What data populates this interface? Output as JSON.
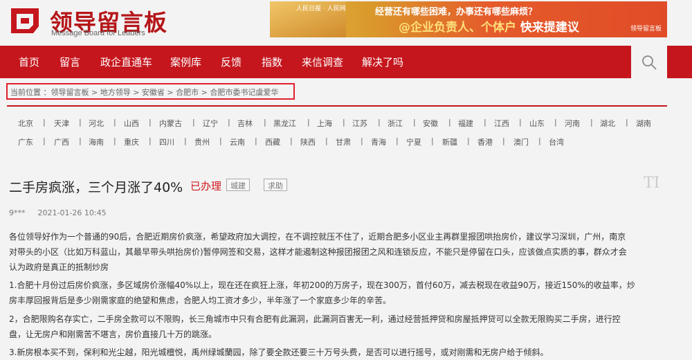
{
  "logo": {
    "title": "领导留言板",
    "subtitle": "Message Board for Leaders"
  },
  "banner": {
    "brand": "人民日报 · 人民网",
    "line1": "经营还有哪些困难，办事还有哪些麻烦？",
    "line2_prefix": "@企业负责人、个体户",
    "line2_suffix": " 快来提建议",
    "corner": "领导留言板"
  },
  "nav": {
    "items": [
      "首页",
      "留言",
      "政企直通车",
      "案例库",
      "反馈",
      "指数",
      "来信调查",
      "解决了吗"
    ]
  },
  "breadcrumb": {
    "text": "当前位置 ：领导留言板 > 地方领导 > 安徽省 > 合肥市 > 合肥市委书记虞爱华"
  },
  "regions": {
    "row1": [
      "北京",
      "天津",
      "河北",
      "山西",
      "内蒙古",
      "辽宁",
      "吉林",
      "黑龙江",
      "上海",
      "江苏",
      "浙江",
      "安徽",
      "福建",
      "江西",
      "山东",
      "河南",
      "湖北",
      "湖南"
    ],
    "row2": [
      "广东",
      "广西",
      "海南",
      "重庆",
      "四川",
      "贵州",
      "云南",
      "西藏",
      "陕西",
      "甘肃",
      "青海",
      "宁夏",
      "新疆",
      "香港",
      "澳门",
      "台湾"
    ]
  },
  "post": {
    "title": "二手房疯涨，三个月涨了40%",
    "status": "已办理",
    "tags": [
      "城建",
      "求助"
    ],
    "author": "9***",
    "date": "2021-01-26 10:45",
    "lines": [
      "各位领导好作为一个普通的90后，合肥近期房价疯涨，希望政府加大调控，在不调控就压不住了，近期合肥多小区业主再群里报团哄抬房价，建议学习深圳，广州，南京",
      "对带头的小区（比如万科蓝山，其最早带头哄抬房价)暂停网签和交易，这样才能遏制这种报团报团之风和连锁反应，不能只是停留在口头，应该做点实质的事，群众才会",
      "认为政府是真正的抵制炒房",
      "1.合肥十月份过后房价疯涨，多区域房价涨幅40%以上，现在还在疯狂上涨，年初200的万房子，现在300万，首付60万，减去税现在收益90万，接近150%的收益率，炒",
      "房丰厚回报背后是多少刚需家庭的绝望和焦虑，合肥人均工资才多少，半年涨了一个家庭多少年的辛苦。",
      "2，合肥限购名存实亡，二手房全款可以不限购，长三角城市中只有合肥有此漏洞，此漏洞百害无一利，通过经营抵押贷和房屋抵押贷可以全款无限购买二手房，进行控",
      "盘，让无房户和刚需苦不堪言，房价直接几十万的跳涨。",
      "3.新房根本买不到，保利和光尘越，阳光城檀悦，禹州绿城蘭园，除了要全款还要三十万号头费，是否可以进行摇号，或对刚需和无房户给于倾斜。"
    ]
  }
}
